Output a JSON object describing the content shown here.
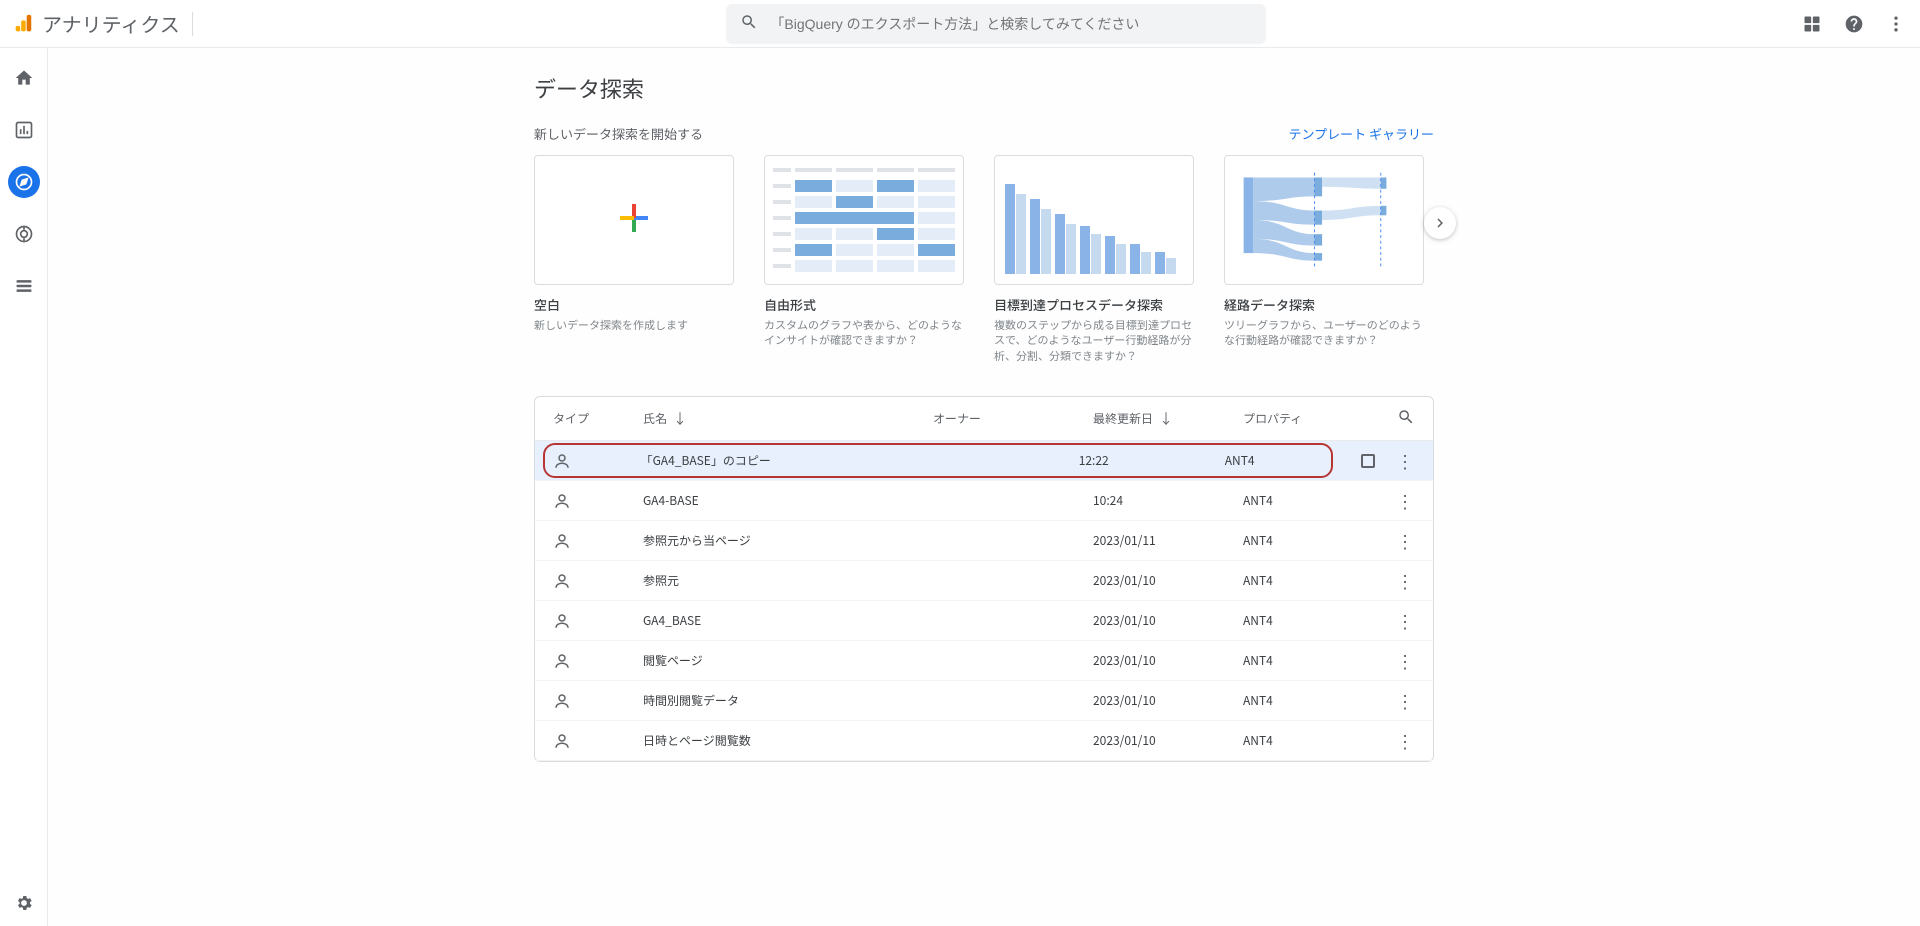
{
  "app_title": "アナリティクス",
  "search_placeholder": "「BigQuery のエクスポート方法」と検索してみてください",
  "page_title": "データ探索",
  "section_subtitle": "新しいデータ探索を開始する",
  "gallery_link": "テンプレート ギャラリー",
  "templates": [
    {
      "title": "空白",
      "desc": "新しいデータ探索を作成します"
    },
    {
      "title": "自由形式",
      "desc": "カスタムのグラフや表から、どのようなインサイトが確認できますか？"
    },
    {
      "title": "目標到達プロセスデータ探索",
      "desc": "複数のステップから成る目標到達プロセスで、どのようなユーザー行動経路が分析、分割、分類できますか？"
    },
    {
      "title": "経路データ探索",
      "desc": "ツリーグラフから、ユーザーのどのような行動経路が確認できますか？"
    }
  ],
  "table": {
    "headers": {
      "type": "タイプ",
      "name": "氏名",
      "owner": "オーナー",
      "date": "最終更新日",
      "property": "プロパティ"
    },
    "rows": [
      {
        "name": "「GA4_BASE」のコピー",
        "date": "12:22",
        "property": "ANT4",
        "hover": true,
        "highlight": true
      },
      {
        "name": "GA4-BASE",
        "date": "10:24",
        "property": "ANT4"
      },
      {
        "name": "参照元から当ページ",
        "date": "2023/01/11",
        "property": "ANT4"
      },
      {
        "name": "参照元",
        "date": "2023/01/10",
        "property": "ANT4"
      },
      {
        "name": "GA4_BASE",
        "date": "2023/01/10",
        "property": "ANT4"
      },
      {
        "name": "閲覧ページ",
        "date": "2023/01/10",
        "property": "ANT4"
      },
      {
        "name": "時間別閲覧データ",
        "date": "2023/01/10",
        "property": "ANT4"
      },
      {
        "name": "日時とページ閲覧数",
        "date": "2023/01/10",
        "property": "ANT4"
      }
    ]
  }
}
